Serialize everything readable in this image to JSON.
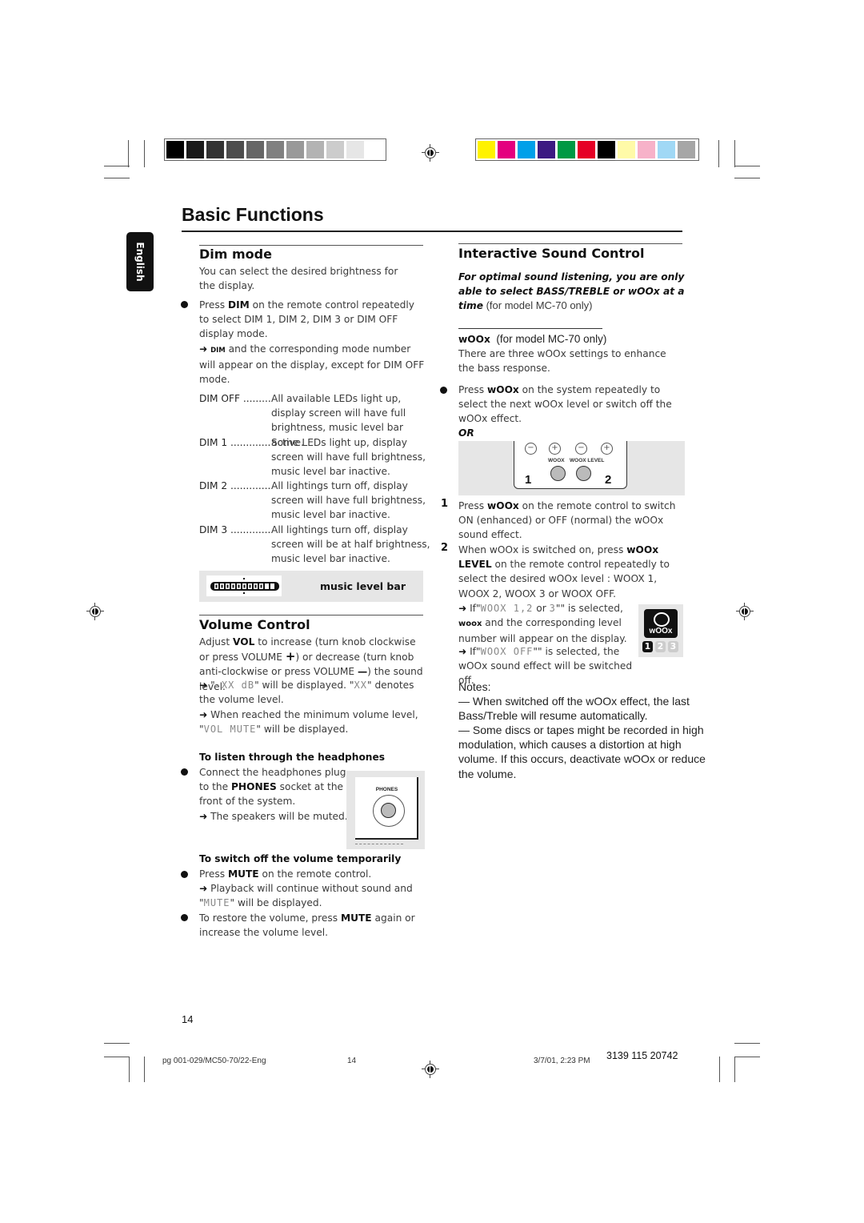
{
  "color_bar": {
    "grayscale": [
      "#000000",
      "#1a1a1a",
      "#333333",
      "#4d4d4d",
      "#666666",
      "#808080",
      "#999999",
      "#b3b3b3",
      "#cccccc",
      "#e6e6e6",
      "#ffffff"
    ],
    "colors": [
      "#fff200",
      "#e4007f",
      "#00a0e9",
      "#3c1a82",
      "#009944",
      "#e60026",
      "#000000",
      "#fffaa8",
      "#f7b2c9",
      "#a0d8f5",
      "#a6a6a6"
    ]
  },
  "page_title": "Basic Functions",
  "language_tab": "English",
  "dim_mode": {
    "heading": "Dim mode",
    "intro": "You can select the desired brightness for the display.",
    "bullet_pre": "Press ",
    "bullet_bold": "DIM",
    "bullet_post": " on the remote control repeatedly to select DIM 1, DIM 2, DIM 3 or DIM OFF display mode.",
    "arrow_glyph": "➜",
    "arrow_small": "DIM",
    "arrow_text": " and the corresponding mode number will appear on the display, except for DIM OFF mode.",
    "modes": [
      {
        "label": "DIM OFF ..................",
        "desc": "All available LEDs light up, display screen will have full brightness, music level bar active."
      },
      {
        "label": "DIM 1 ............................",
        "desc": "Some LEDs light up, display screen will have full brightness, music level bar inactive."
      },
      {
        "label": "DIM 2 ............................",
        "desc": "All lightings turn off, display screen will have full brightness, music level bar inactive."
      },
      {
        "label": "DIM 3 ............................",
        "desc": "All lightings turn off, display screen will be at half brightness, music level bar inactive."
      }
    ],
    "music_level_bar_label": "music level bar",
    "music_level_bar_segments_lit": 9,
    "music_level_bar_segments_total": 11
  },
  "volume_control": {
    "heading": "Volume Control",
    "line1_pre": "Adjust ",
    "line1_bold": "VOL",
    "line1_post": " to increase (turn knob clockwise or press VOLUME ",
    "plus": "+",
    "line1_mid": ") or decrease (turn knob anti-clockwise or press VOLUME ",
    "minus": "—",
    "line1_end": ") the sound level.",
    "arrow1_pre": " \"",
    "arrow1_lcd": "-XX dB",
    "arrow1_mid": "\" will be displayed. \"",
    "arrow1_lcd2": "XX",
    "arrow1_post": "\" denotes the volume level.",
    "arrow2_text": " When reached the minimum volume level, \"",
    "arrow2_lcd": "VOL MUTE",
    "arrow2_post": "\" will be displayed.",
    "headphones": {
      "subheading": "To listen through the headphones",
      "bullet_pre": "Connect the headphones plug to the ",
      "bullet_bold": "PHONES",
      "bullet_post": " socket at the front of the system.",
      "arrow_text": " The speakers will be muted.",
      "socket_label": "PHONES"
    },
    "mute": {
      "subheading": "To switch off the volume temporarily",
      "bullet1_pre": "Press ",
      "bullet1_bold": "MUTE",
      "bullet1_post": " on the remote control.",
      "arrow_pre": " Playback will continue without sound and \"",
      "arrow_lcd": "MUTE",
      "arrow_post": "\" will be displayed.",
      "bullet2_pre": "To restore the volume, press ",
      "bullet2_bold": "MUTE",
      "bullet2_post": " again or increase the volume level."
    }
  },
  "interactive_sound": {
    "heading": "Interactive Sound Control",
    "intro_italic": "For optimal sound listening, you are only able to select BASS/TREBLE or wOOx at a time",
    "intro_plain": " (for model MC-70 only)",
    "woox_heading_bold": "wOOx",
    "woox_heading_plain": "  (for model MC-70 only)",
    "woox_intro": "There are three wOOx settings to enhance the bass response.",
    "bullet_pre": "Press ",
    "bullet_bold": "wOOx",
    "bullet_post": " on the system repeatedly to select the next wOOx level or switch off the wOOx effect.",
    "or_label": "OR",
    "remote": {
      "button1_label": "WOOX",
      "button2_label": "WOOX LEVEL",
      "callout1": "1",
      "callout2": "2"
    },
    "steps": [
      {
        "num": "1",
        "pre": "Press ",
        "bold": "wOOx",
        "post": " on the remote control to switch ON (enhanced) or OFF (normal) the wOOx sound effect."
      },
      {
        "num": "2",
        "pre": "When wOOx is switched on, press ",
        "bold": "wOOx LEVEL",
        "post": " on the remote control repeatedly to select the desired wOOx level : WOOX 1, WOOX 2, WOOX 3 or WOOX OFF."
      }
    ],
    "arrow1_pre": " If\"",
    "arrow1_lcd": "WOOX  1,2",
    "arrow1_mid": " or ",
    "arrow1_lcd2": "3",
    "arrow1_post": "\"\" is selected,",
    "arrow1_line2_bold": "woox",
    "arrow1_line2": " and the corresponding level number will appear on the display.",
    "arrow2_pre": " If\"",
    "arrow2_lcd": "WOOX OFF",
    "arrow2_post": "\"\" is selected, the wOOx sound effect will be switched off.",
    "badge": {
      "logo_text": "wOOx",
      "levels": [
        "1",
        "2",
        "3"
      ],
      "active_level": "1"
    },
    "notes": {
      "label": "Notes:",
      "items": [
        "—  When switched off the wOOx effect, the last Bass/Treble will resume automatically.",
        "—  Some discs or tapes might be recorded in high modulation, which causes a distortion at high volume. If this occurs, deactivate wOOx or reduce the volume."
      ]
    }
  },
  "page_number": "14",
  "footer": {
    "file": "pg 001-029/MC50-70/22-Eng",
    "page": "14",
    "date": "3/7/01, 2:23 PM",
    "code": "3139 115 20742"
  }
}
